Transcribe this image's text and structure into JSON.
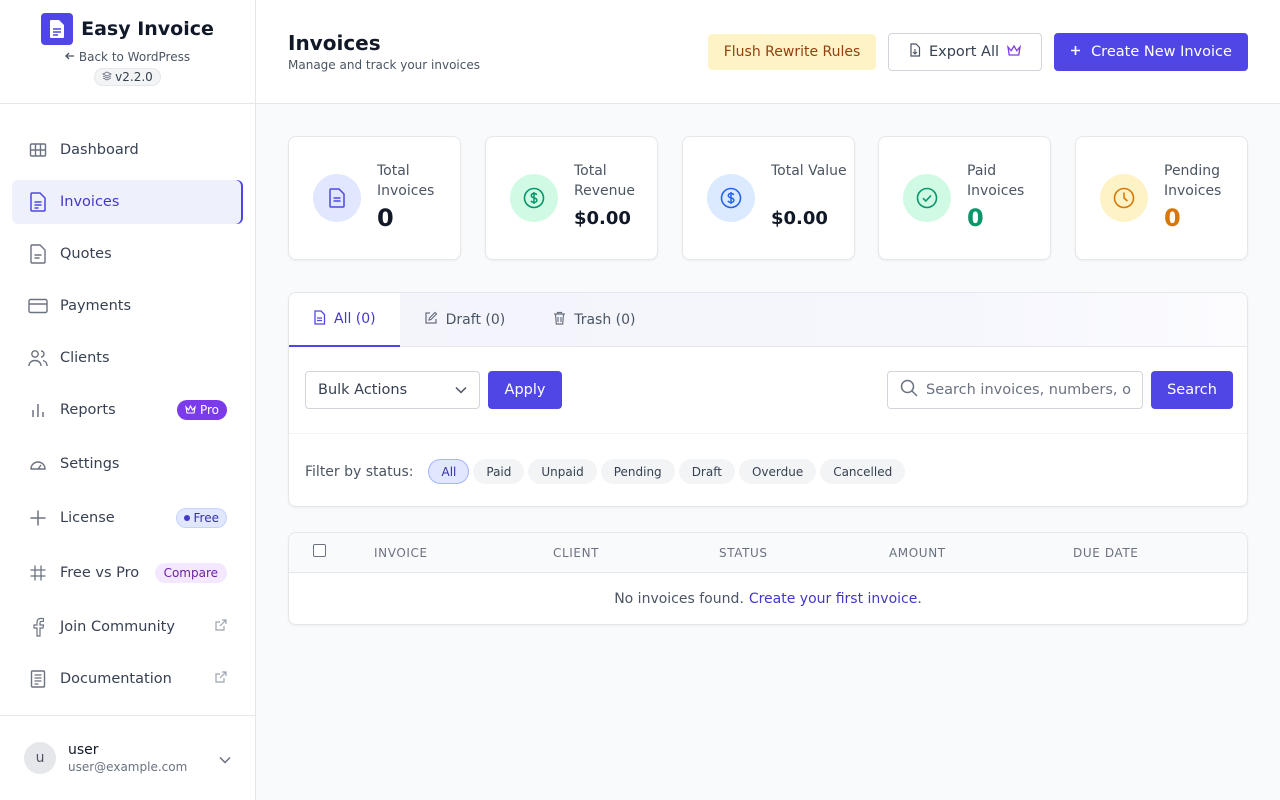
{
  "brand": {
    "name": "Easy Invoice",
    "back_link": "Back to WordPress",
    "version": "v2.2.0"
  },
  "sidebar": {
    "items": [
      {
        "label": "Dashboard",
        "icon": "grid-icon"
      },
      {
        "label": "Invoices",
        "icon": "document-icon",
        "active": true
      },
      {
        "label": "Quotes",
        "icon": "quote-document-icon"
      },
      {
        "label": "Payments",
        "icon": "credit-card-icon"
      },
      {
        "label": "Clients",
        "icon": "users-icon"
      },
      {
        "label": "Reports",
        "icon": "bar-chart-icon",
        "badge": "Pro"
      },
      {
        "label": "Settings",
        "icon": "gauge-icon"
      },
      {
        "label": "License",
        "icon": "sparkle-icon",
        "badge": "Free"
      },
      {
        "label": "Free vs Pro",
        "icon": "hash-icon",
        "badge": "Compare"
      },
      {
        "label": "Join Community",
        "icon": "facebook-icon",
        "external": true
      },
      {
        "label": "Documentation",
        "icon": "book-icon",
        "external": true
      }
    ]
  },
  "user": {
    "initial": "u",
    "name": "user",
    "email": "user@example.com"
  },
  "header": {
    "title": "Invoices",
    "subtitle": "Manage and track your invoices",
    "flush_label": "Flush Rewrite Rules",
    "export_label": "Export All",
    "create_label": "Create New Invoice"
  },
  "stats": [
    {
      "label": "Total Invoices",
      "value": "0",
      "color": "#111827",
      "icon": "document-icon",
      "bg": "#e0e7ff",
      "fg": "#4f46e5"
    },
    {
      "label": "Total Revenue",
      "value": "$0.00",
      "color": "#111827",
      "icon": "dollar-circle-icon",
      "bg": "#d1fae5",
      "fg": "#059669"
    },
    {
      "label": "Total Value",
      "value": "$0.00",
      "color": "#111827",
      "icon": "dollar-circle-icon",
      "bg": "#dbeafe",
      "fg": "#2563eb"
    },
    {
      "label": "Paid Invoices",
      "value": "0",
      "color": "#059669",
      "icon": "check-circle-icon",
      "bg": "#d1fae5",
      "fg": "#059669"
    },
    {
      "label": "Pending Invoices",
      "value": "0",
      "color": "#d97706",
      "icon": "clock-icon",
      "bg": "#fef3c7",
      "fg": "#d97706"
    }
  ],
  "tabs": [
    {
      "label": "All (0)",
      "active": true
    },
    {
      "label": "Draft (0)"
    },
    {
      "label": "Trash (0)"
    }
  ],
  "toolbar": {
    "bulk_actions": "Bulk Actions",
    "apply_label": "Apply",
    "search_placeholder": "Search invoices, numbers, or",
    "search_label": "Search"
  },
  "filters": {
    "label": "Filter by status:",
    "options": [
      "All",
      "Paid",
      "Unpaid",
      "Pending",
      "Draft",
      "Overdue",
      "Cancelled"
    ],
    "selected": "All"
  },
  "table": {
    "columns": [
      "INVOICE",
      "CLIENT",
      "STATUS",
      "AMOUNT",
      "DUE DATE"
    ],
    "empty_text": "No invoices found.",
    "empty_link": "Create your first invoice"
  },
  "colors": {
    "accent": "#4f46e5",
    "pro_badge": "#7c3aed",
    "flush_bg": "#fef3c7"
  }
}
